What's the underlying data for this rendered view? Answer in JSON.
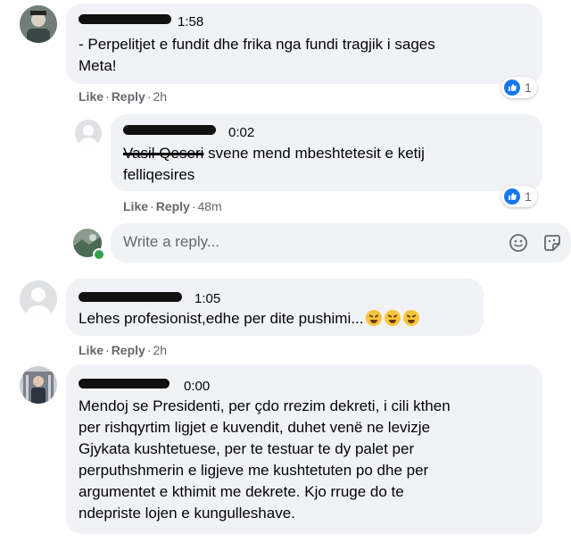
{
  "comments": [
    {
      "time": "1:58",
      "text": "- Perpelitjet e fundit dhe frika nga fundi tragjik i sages\nMeta!",
      "like_label": "Like",
      "reply_label": "Reply",
      "age": "2h",
      "reaction_count": "1"
    },
    {
      "time": "0:02",
      "mention": "Vasil Qeseri",
      "text": " svene mend mbeshtetesit e ketij\nfelliqesires",
      "like_label": "Like",
      "reply_label": "Reply",
      "age": "48m",
      "reaction_count": "1"
    },
    {
      "time": "1:05",
      "text": "Lehes profesionist,edhe per dite pushimi...",
      "like_label": "Like",
      "reply_label": "Reply",
      "age": "2h"
    },
    {
      "time": "0:00",
      "text": "Mendoj se Presidenti, per çdo rrezim dekreti, i cili kthen\nper rishqyrtim ligjet e kuvendit, duhet venë ne levizje\nGjykata kushtetuese, per te testuar te dy palet per\nperputhshmerin e ligjeve me kushtetuten po dhe per\nargumentet e kthimit me dekrete. Kjo rruge do te\nndepriste lojen e kungulleshave."
    }
  ],
  "reply_box": {
    "placeholder": "Write a reply..."
  },
  "separator": "·"
}
